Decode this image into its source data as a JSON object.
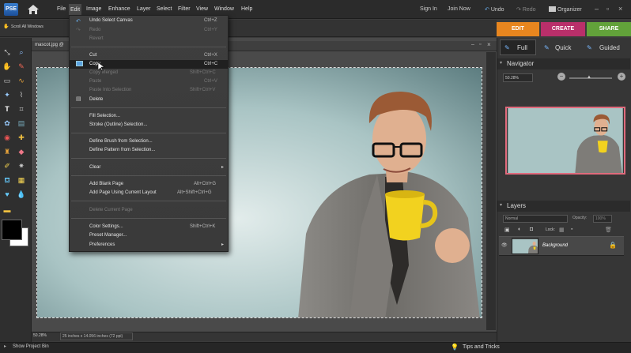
{
  "app": {
    "logo_text": "PSE"
  },
  "menubar": {
    "items": [
      "File",
      "Edit",
      "Image",
      "Enhance",
      "Layer",
      "Select",
      "Filter",
      "View",
      "Window",
      "Help"
    ],
    "right": {
      "sign_in": "Sign In",
      "join_now": "Join Now",
      "undo": "Undo",
      "redo": "Redo",
      "organizer": "Organizer"
    }
  },
  "optionbar": {
    "scroll_all": "Scroll All Windows"
  },
  "mode_tabs": {
    "edit": "EDIT",
    "create": "CREATE",
    "share": "SHARE"
  },
  "colors": {
    "edit_tab": "#e8861f",
    "create_tab": "#c0306e",
    "share_tab": "#6aa83a",
    "thumb_border": "#e06a7c",
    "mug": "#f2d21f"
  },
  "document": {
    "tab_label": "mascot.jpg @",
    "zoom": "50.28%",
    "size_info": "25 inches x 14.056 inches (72 ppi)"
  },
  "view_buttons": {
    "full": "Full",
    "quick": "Quick",
    "guided": "Guided"
  },
  "navigator": {
    "title": "Navigator",
    "zoom": "50.28%"
  },
  "layers": {
    "title": "Layers",
    "blend_mode": "Normal",
    "opacity_label": "Opacity:",
    "opacity_value": "100%",
    "lock_label": "Lock:",
    "layer_name": "Background"
  },
  "bottombar": {
    "project_bin": "Show Project Bin",
    "tips": "Tips and Tricks"
  },
  "edit_menu": {
    "undo": {
      "label": "Undo Select Canvas",
      "shortcut": "Ctrl+Z"
    },
    "redo": {
      "label": "Redo",
      "shortcut": "Ctrl+Y"
    },
    "revert": {
      "label": "Revert"
    },
    "cut": {
      "label": "Cut",
      "shortcut": "Ctrl+X"
    },
    "copy": {
      "label": "Copy",
      "shortcut": "Ctrl+C"
    },
    "copy_merged": {
      "label": "Copy Merged",
      "shortcut": "Shift+Ctrl+C"
    },
    "paste": {
      "label": "Paste",
      "shortcut": "Ctrl+V"
    },
    "paste_into": {
      "label": "Paste Into Selection",
      "shortcut": "Shift+Ctrl+V"
    },
    "delete": {
      "label": "Delete"
    },
    "fill": {
      "label": "Fill Selection..."
    },
    "stroke": {
      "label": "Stroke (Outline) Selection..."
    },
    "define_brush": {
      "label": "Define Brush from Selection..."
    },
    "define_pattern": {
      "label": "Define Pattern from Selection..."
    },
    "clear": {
      "label": "Clear"
    },
    "add_blank": {
      "label": "Add Blank Page",
      "shortcut": "Alt+Ctrl+G"
    },
    "add_layout": {
      "label": "Add Page Using Current Layout",
      "shortcut": "Alt+Shift+Ctrl+G"
    },
    "delete_page": {
      "label": "Delete Current Page"
    },
    "color_settings": {
      "label": "Color Settings...",
      "shortcut": "Shift+Ctrl+K"
    },
    "preset_manager": {
      "label": "Preset Manager..."
    },
    "preferences": {
      "label": "Preferences"
    }
  }
}
